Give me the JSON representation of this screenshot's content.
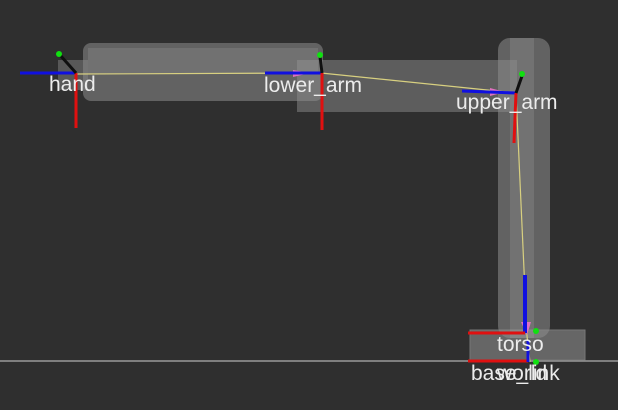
{
  "scene": {
    "background_color": "#2f2f2f",
    "floor_color": "#9a9a9a",
    "link_color": "#8c8c8c",
    "edge_color": "#c8c0a0"
  },
  "frames": {
    "hand": "hand",
    "lower_arm": "lower_arm",
    "upper_arm": "upper_arm",
    "torso": "torso",
    "base_link": "base_link",
    "world": "world"
  },
  "axis_colors": {
    "x": "#e01010",
    "y": "#10d010",
    "z": "#1010e0"
  }
}
